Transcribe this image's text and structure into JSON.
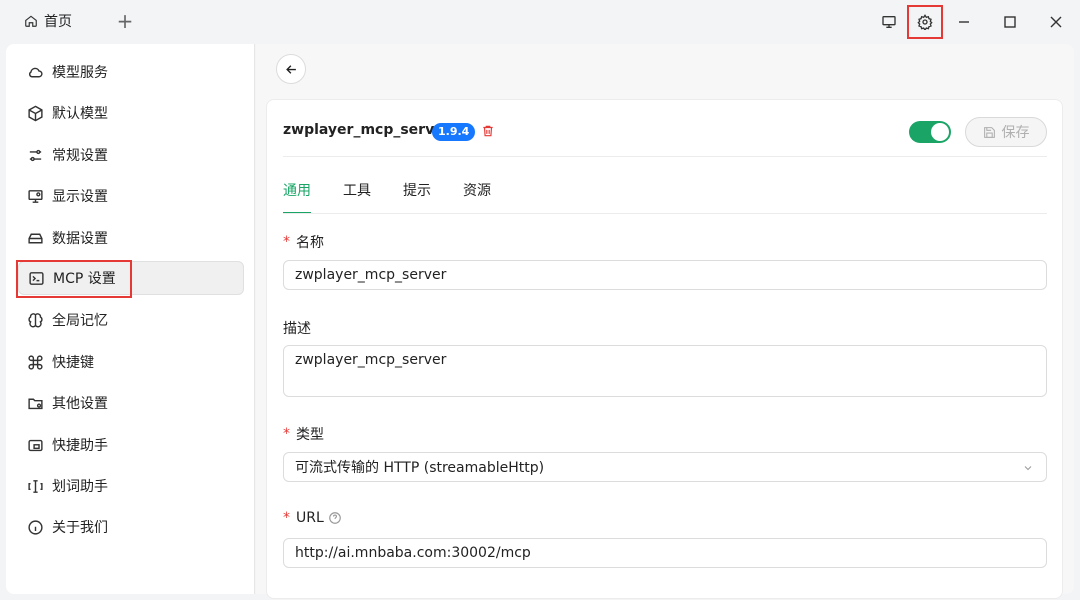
{
  "titlebar": {
    "home_tab": "首页",
    "add_tab": "+"
  },
  "sidebar": {
    "items": [
      {
        "label": "模型服务",
        "icon": "cloud-icon"
      },
      {
        "label": "默认模型",
        "icon": "cube-icon"
      },
      {
        "label": "常规设置",
        "icon": "sliders-icon"
      },
      {
        "label": "显示设置",
        "icon": "monitor-settings-icon"
      },
      {
        "label": "数据设置",
        "icon": "hard-drive-icon"
      },
      {
        "label": "MCP 设置",
        "icon": "terminal-icon"
      },
      {
        "label": "全局记忆",
        "icon": "brain-icon"
      },
      {
        "label": "快捷键",
        "icon": "command-icon"
      },
      {
        "label": "其他设置",
        "icon": "folder-cog-icon"
      },
      {
        "label": "快捷助手",
        "icon": "app-window-icon"
      },
      {
        "label": "划词助手",
        "icon": "text-cursor-icon"
      },
      {
        "label": "关于我们",
        "icon": "info-icon"
      }
    ],
    "active_index": 5
  },
  "server": {
    "name": "zwplayer_mcp_server",
    "version": "1.9.4",
    "enabled": true,
    "save_label": "保存"
  },
  "tabs": [
    {
      "label": "通用",
      "active": true
    },
    {
      "label": "工具",
      "active": false
    },
    {
      "label": "提示",
      "active": false
    },
    {
      "label": "资源",
      "active": false
    }
  ],
  "form": {
    "name_label": "名称",
    "name_value": "zwplayer_mcp_server",
    "desc_label": "描述",
    "desc_value": "zwplayer_mcp_server",
    "type_label": "类型",
    "type_value": "可流式传输的 HTTP (streamableHttp)",
    "url_label": "URL",
    "url_value": "http://ai.mnbaba.com:30002/mcp",
    "required_mark": "*"
  },
  "colors": {
    "accent": "#1aa566",
    "badge": "#1677ff",
    "highlight": "#e53935"
  }
}
